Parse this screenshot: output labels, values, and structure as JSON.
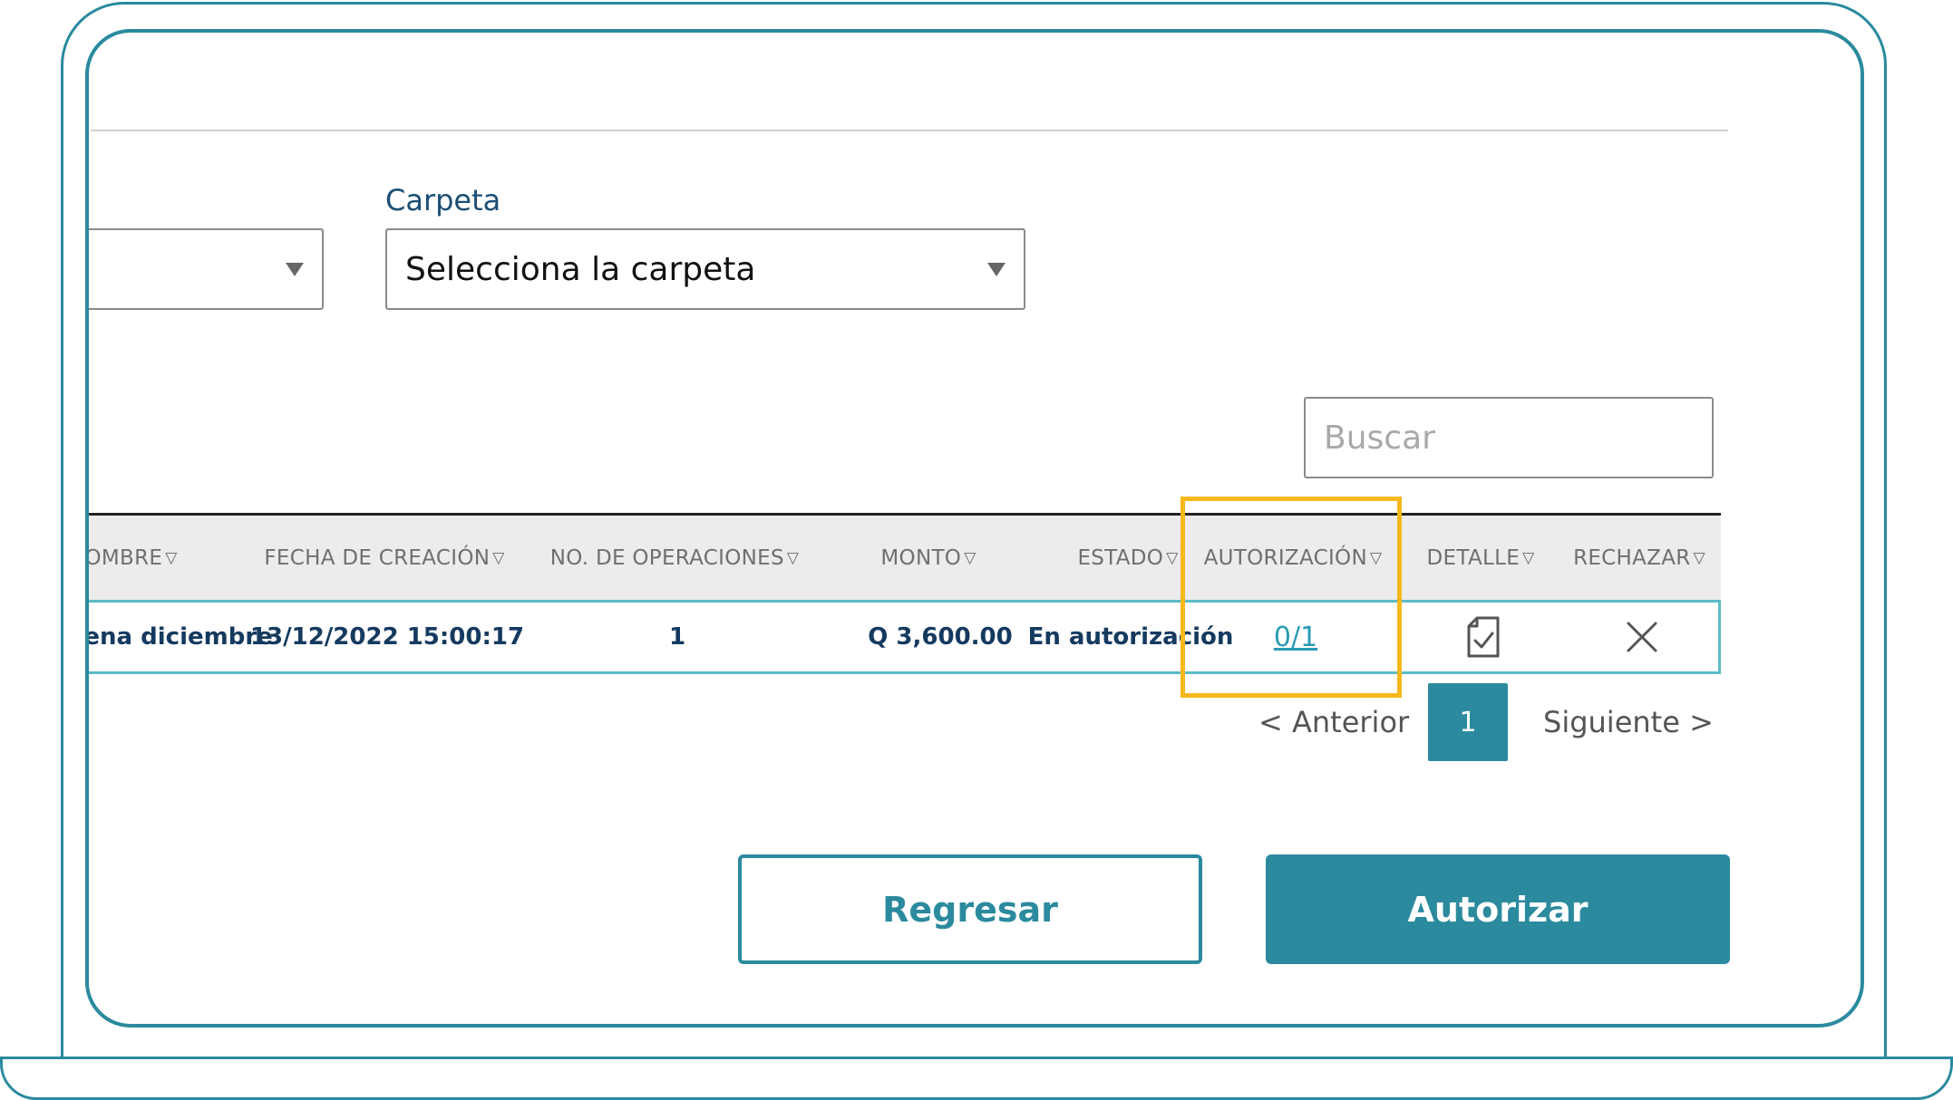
{
  "filters": {
    "left_select_value": "",
    "folder_label": "Carpeta",
    "folder_placeholder": "Selecciona la carpeta"
  },
  "search": {
    "placeholder": "Buscar"
  },
  "table": {
    "columns": [
      "NOMBRE",
      "FECHA DE CREACIÓN",
      "NO. DE OPERACIONES",
      "MONTO",
      "ESTADO",
      "AUTORIZACIÓN",
      "DETALLE",
      "RECHAZAR"
    ],
    "rows": [
      {
        "nombre": "cena diciembre",
        "fecha": "13/12/2022 15:00:17",
        "operaciones": "1",
        "monto": "Q 3,600.00",
        "estado": "En autorización",
        "autorizacion": "0/1"
      }
    ]
  },
  "pagination": {
    "prev": "< Anterior",
    "page": "1",
    "next": "Siguiente >"
  },
  "actions": {
    "back": "Regresar",
    "authorize": "Autorizar"
  },
  "icons": {
    "sort": "sort-down-icon",
    "detail": "document-check-icon",
    "reject": "close-icon",
    "caret": "caret-down-icon"
  },
  "colors": {
    "accent": "#2b8a9e",
    "highlight": "#f6b81a",
    "row_border": "#5cbcc7",
    "text_dark": "#153a60"
  }
}
